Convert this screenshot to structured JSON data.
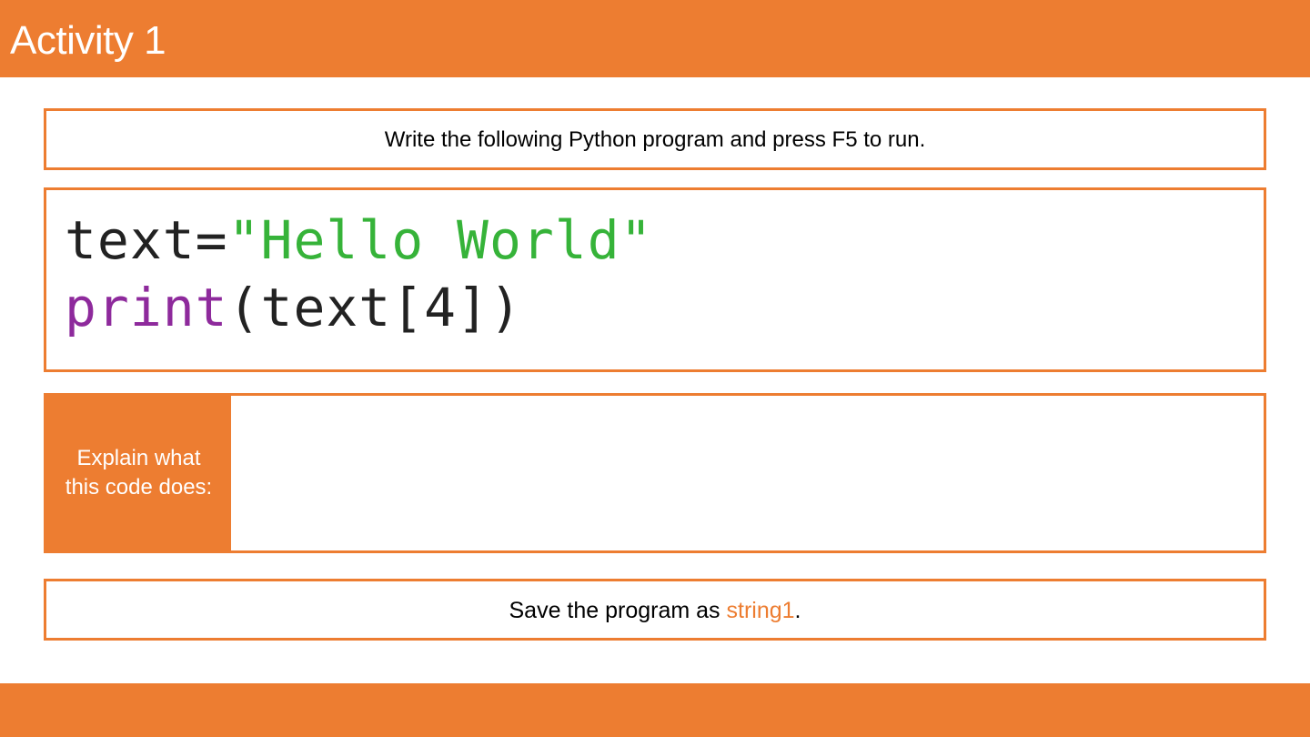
{
  "header": {
    "title": "Activity 1"
  },
  "instruction": {
    "text": "Write the following Python program and press F5 to run."
  },
  "code": {
    "line1": {
      "var": "text=",
      "string": "\"Hello World\""
    },
    "line2": {
      "func": "print",
      "rest": "(text[4])"
    }
  },
  "explain": {
    "label": "Explain what this code does:",
    "answer": ""
  },
  "save": {
    "prefix": "Save the program as ",
    "filename": "string1",
    "suffix": "."
  },
  "colors": {
    "accent": "#ED7D31",
    "code_string": "#36B339",
    "code_builtin": "#8E2A9C",
    "code_default": "#222222"
  }
}
